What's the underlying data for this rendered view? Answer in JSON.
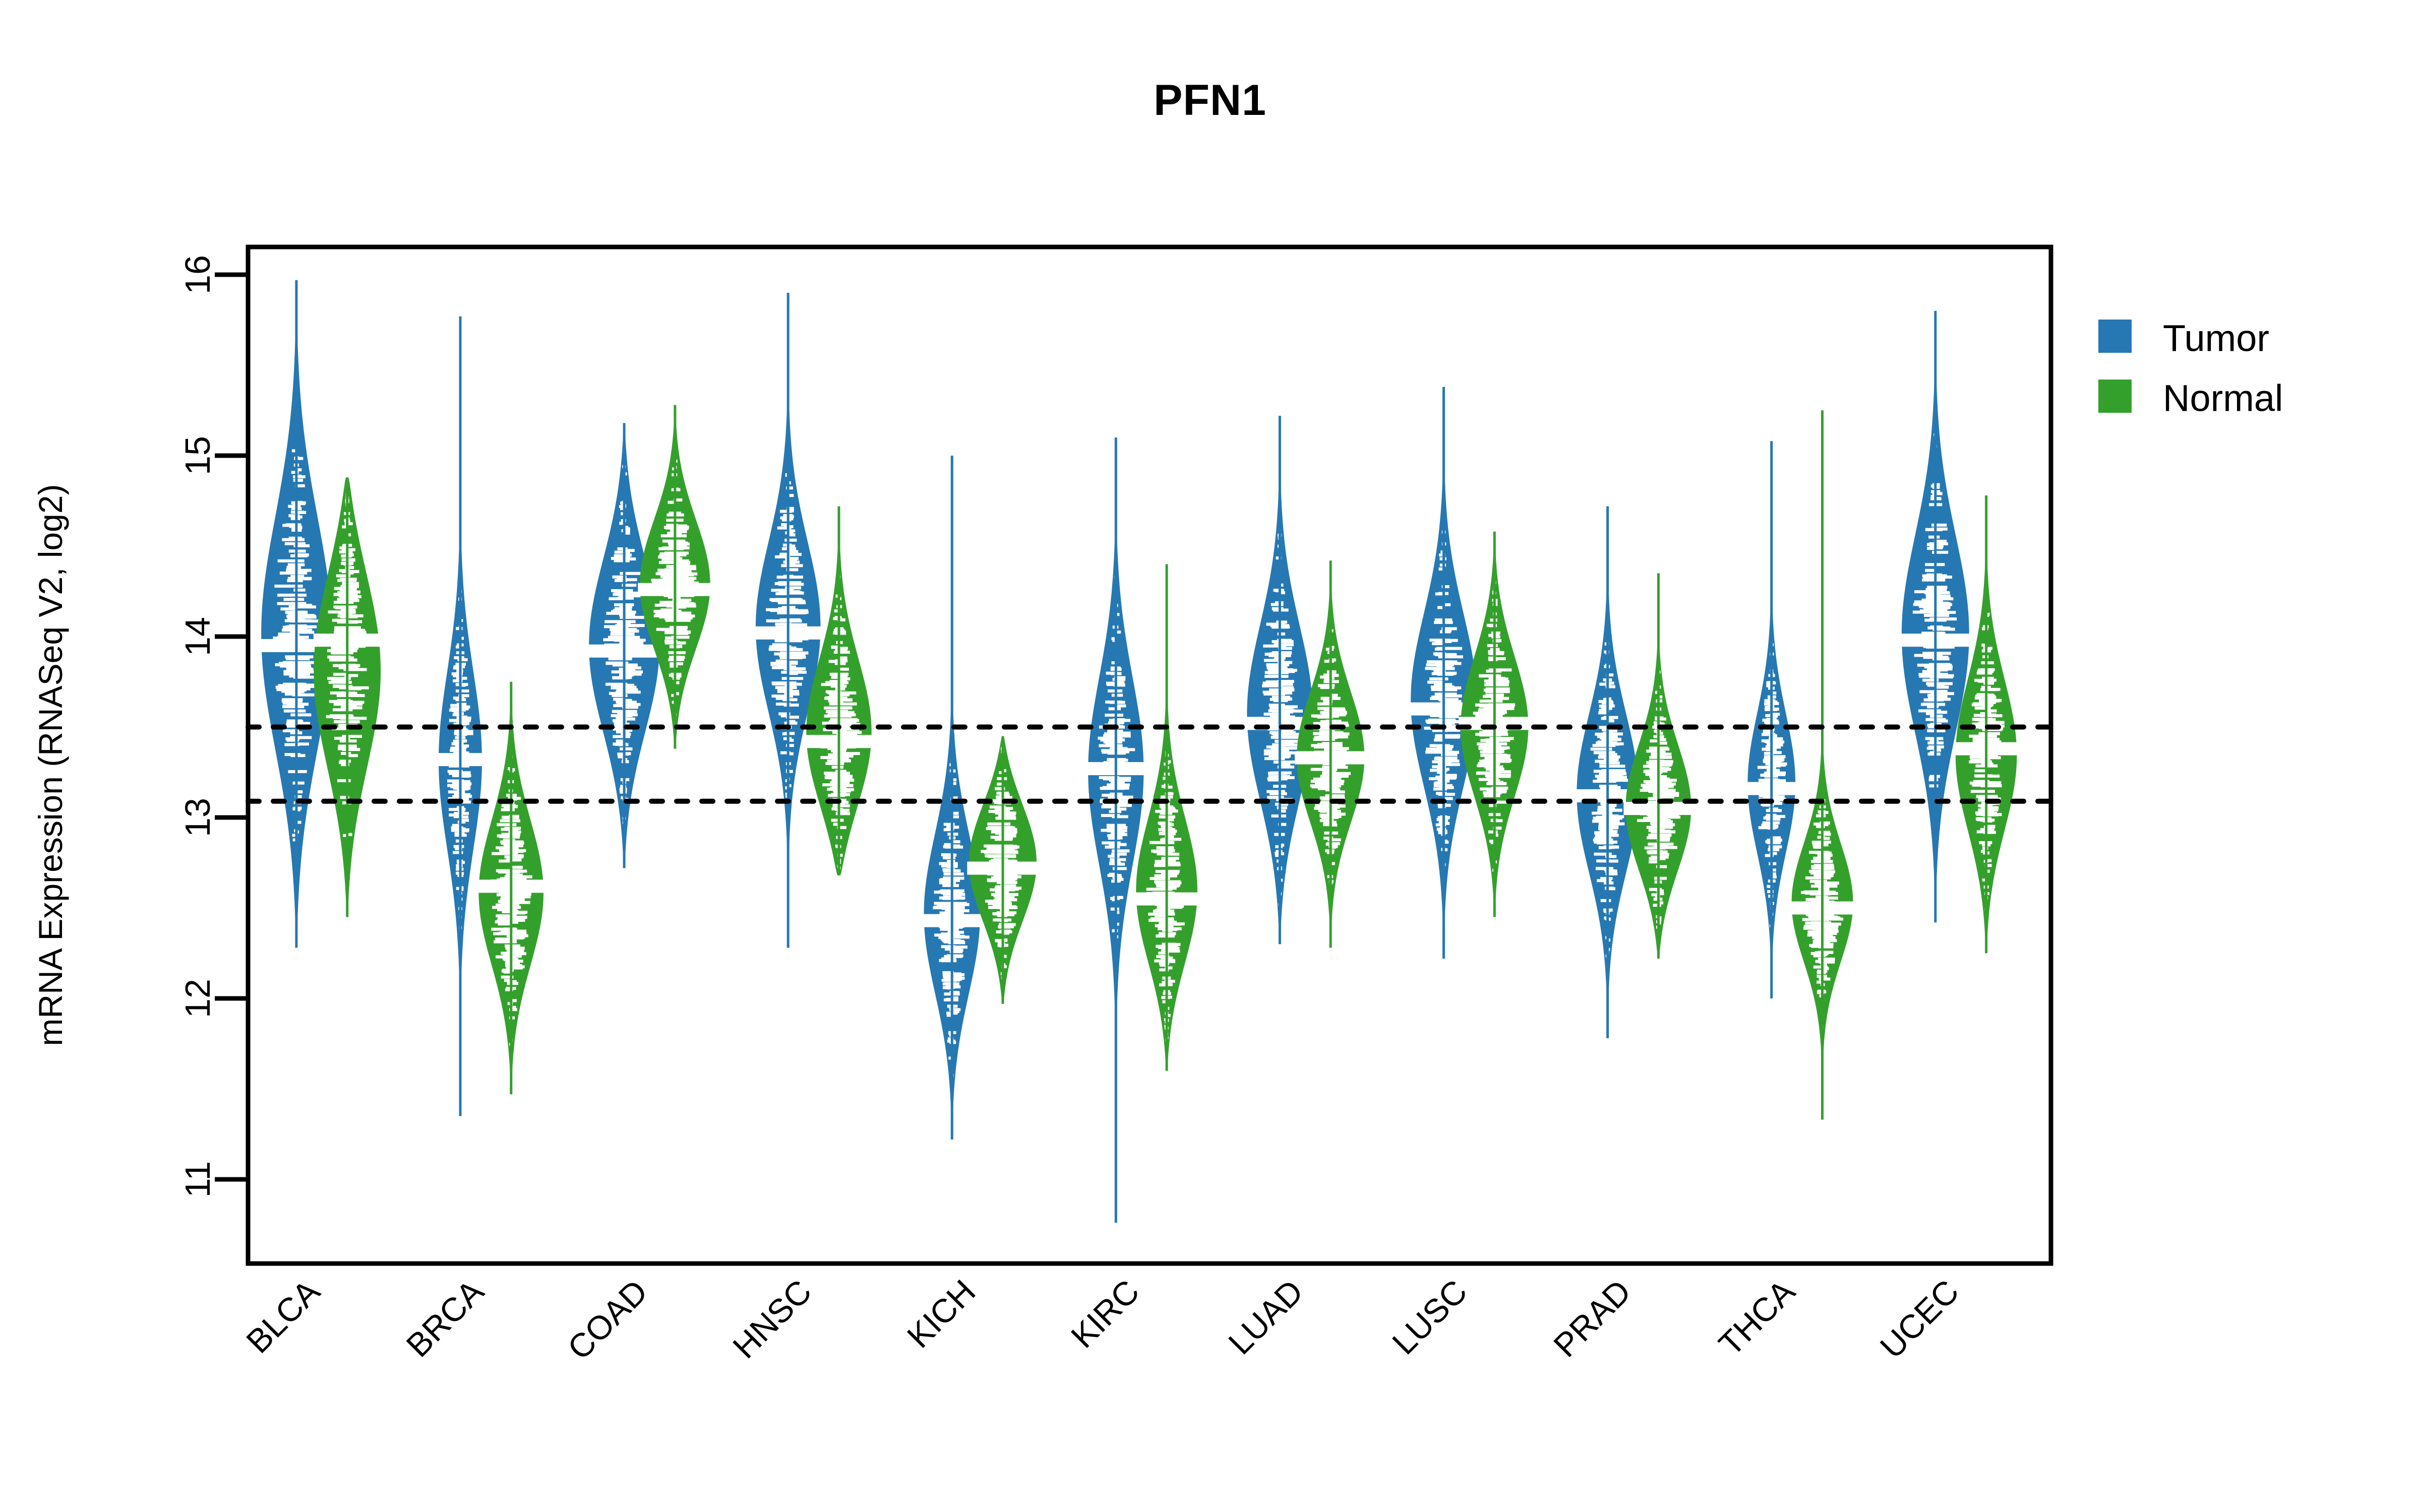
{
  "chart_data": {
    "type": "violin",
    "title": "PFN1",
    "xlabel": "",
    "ylabel": "mRNA Expression (RNASeq V2, log2)",
    "ylim": [
      10.6,
      16.25
    ],
    "yticks": [
      11,
      12,
      13,
      14,
      15,
      16
    ],
    "ytick_labels": [
      "11",
      "12",
      "13",
      "14",
      "15",
      "16"
    ],
    "grid": false,
    "legend_position": "right",
    "reference_lines": [
      13.5,
      13.09
    ],
    "reference_line_style": "dotted",
    "categories": [
      "BLCA",
      "BRCA",
      "COAD",
      "HNSC",
      "KICH",
      "KIRC",
      "LUAD",
      "LUSC",
      "PRAD",
      "THCA",
      "UCEC"
    ],
    "series": [
      {
        "name": "Tumor",
        "color": "#2678B2",
        "stats": [
          {
            "category": "BLCA",
            "median": 13.95,
            "q1": 13.45,
            "q3": 14.38,
            "min": 12.28,
            "max": 15.97,
            "whisker_low": 12.6,
            "whisker_high": 15.3,
            "density_peak": 14.0,
            "width": 1.0
          },
          {
            "category": "BRCA",
            "median": 13.32,
            "q1": 13.02,
            "q3": 13.7,
            "min": 11.35,
            "max": 15.77,
            "whisker_low": 12.3,
            "whisker_high": 14.7,
            "density_peak": 13.3,
            "width": 0.62
          },
          {
            "category": "COAD",
            "median": 13.92,
            "q1": 13.55,
            "q3": 14.25,
            "min": 12.72,
            "max": 15.18,
            "whisker_low": 13.1,
            "whisker_high": 14.8,
            "density_peak": 13.95,
            "width": 1.0
          },
          {
            "category": "HNSC",
            "median": 14.02,
            "q1": 13.72,
            "q3": 14.38,
            "min": 12.28,
            "max": 15.9,
            "whisker_low": 13.3,
            "whisker_high": 14.9,
            "density_peak": 14.05,
            "width": 0.92
          },
          {
            "category": "KICH",
            "median": 12.43,
            "q1": 12.1,
            "q3": 12.72,
            "min": 11.22,
            "max": 15.0,
            "whisker_low": 11.5,
            "whisker_high": 13.1,
            "density_peak": 12.42,
            "width": 0.86
          },
          {
            "category": "KIRC",
            "median": 13.27,
            "q1": 12.9,
            "q3": 13.62,
            "min": 10.76,
            "max": 15.1,
            "whisker_low": 11.7,
            "whisker_high": 14.5,
            "density_peak": 13.28,
            "width": 0.8
          },
          {
            "category": "LUAD",
            "median": 13.52,
            "q1": 13.2,
            "q3": 13.9,
            "min": 12.3,
            "max": 15.22,
            "whisker_low": 12.7,
            "whisker_high": 14.7,
            "density_peak": 13.55,
            "width": 0.94
          },
          {
            "category": "LUSC",
            "median": 13.6,
            "q1": 13.28,
            "q3": 13.96,
            "min": 12.22,
            "max": 15.38,
            "whisker_low": 12.8,
            "whisker_high": 14.6,
            "density_peak": 13.63,
            "width": 0.94
          },
          {
            "category": "PRAD",
            "median": 13.12,
            "q1": 12.82,
            "q3": 13.44,
            "min": 11.78,
            "max": 14.72,
            "whisker_low": 12.3,
            "whisker_high": 14.1,
            "density_peak": 13.12,
            "width": 0.88
          },
          {
            "category": "THCA",
            "median": 13.16,
            "q1": 12.9,
            "q3": 13.44,
            "min": 12.0,
            "max": 15.08,
            "whisker_low": 12.5,
            "whisker_high": 14.3,
            "density_peak": 13.16,
            "width": 0.7
          },
          {
            "category": "UCEC",
            "median": 13.98,
            "q1": 13.6,
            "q3": 14.38,
            "min": 12.42,
            "max": 15.8,
            "whisker_low": 13.1,
            "whisker_high": 15.1,
            "density_peak": 14.0,
            "width": 0.96
          }
        ]
      },
      {
        "name": "Normal",
        "color": "#34A02C",
        "stats": [
          {
            "category": "BLCA",
            "median": 13.98,
            "q1": 13.55,
            "q3": 14.35,
            "min": 12.45,
            "max": 14.88,
            "whisker_low": 12.8,
            "whisker_high": 14.7,
            "density_peak": 13.85,
            "width": 0.96
          },
          {
            "category": "BRCA",
            "median": 12.62,
            "q1": 12.38,
            "q3": 12.96,
            "min": 11.47,
            "max": 13.75,
            "whisker_low": 11.9,
            "whisker_high": 13.5,
            "density_peak": 12.58,
            "width": 0.92
          },
          {
            "category": "COAD",
            "median": 14.26,
            "q1": 14.0,
            "q3": 14.52,
            "min": 13.38,
            "max": 15.28,
            "whisker_low": 13.6,
            "whisker_high": 14.9,
            "density_peak": 14.28,
            "width": 1.0
          },
          {
            "category": "HNSC",
            "median": 13.42,
            "q1": 13.12,
            "q3": 13.72,
            "min": 12.68,
            "max": 14.72,
            "whisker_low": 12.9,
            "whisker_high": 14.2,
            "density_peak": 13.42,
            "width": 0.96
          },
          {
            "category": "KICH",
            "median": 12.72,
            "q1": 12.52,
            "q3": 13.0,
            "min": 11.97,
            "max": 13.45,
            "whisker_low": 12.2,
            "whisker_high": 13.3,
            "density_peak": 12.76,
            "width": 0.96
          },
          {
            "category": "KIRC",
            "median": 12.55,
            "q1": 12.28,
            "q3": 12.85,
            "min": 11.6,
            "max": 14.4,
            "whisker_low": 11.9,
            "whisker_high": 13.5,
            "density_peak": 12.55,
            "width": 0.92
          },
          {
            "category": "LUAD",
            "median": 13.33,
            "q1": 13.08,
            "q3": 13.6,
            "min": 12.28,
            "max": 14.42,
            "whisker_low": 12.6,
            "whisker_high": 14.1,
            "density_peak": 13.33,
            "width": 0.96
          },
          {
            "category": "LUSC",
            "median": 13.52,
            "q1": 13.22,
            "q3": 13.78,
            "min": 12.45,
            "max": 14.58,
            "whisker_low": 12.8,
            "whisker_high": 14.2,
            "density_peak": 13.5,
            "width": 0.96
          },
          {
            "category": "PRAD",
            "median": 13.05,
            "q1": 12.8,
            "q3": 13.3,
            "min": 12.22,
            "max": 14.35,
            "whisker_low": 12.4,
            "whisker_high": 13.9,
            "density_peak": 13.02,
            "width": 0.96
          },
          {
            "category": "THCA",
            "median": 12.5,
            "q1": 12.3,
            "q3": 12.75,
            "min": 11.33,
            "max": 15.25,
            "whisker_low": 11.9,
            "whisker_high": 13.2,
            "density_peak": 12.5,
            "width": 0.96
          },
          {
            "category": "UCEC",
            "median": 13.38,
            "q1": 13.1,
            "q3": 13.7,
            "min": 12.25,
            "max": 14.78,
            "whisker_low": 12.7,
            "whisker_high": 14.2,
            "density_peak": 13.32,
            "width": 0.88
          }
        ]
      }
    ]
  },
  "legend": {
    "items": [
      {
        "label": "Tumor",
        "color": "#2678B2"
      },
      {
        "label": "Normal",
        "color": "#34A02C"
      }
    ]
  }
}
